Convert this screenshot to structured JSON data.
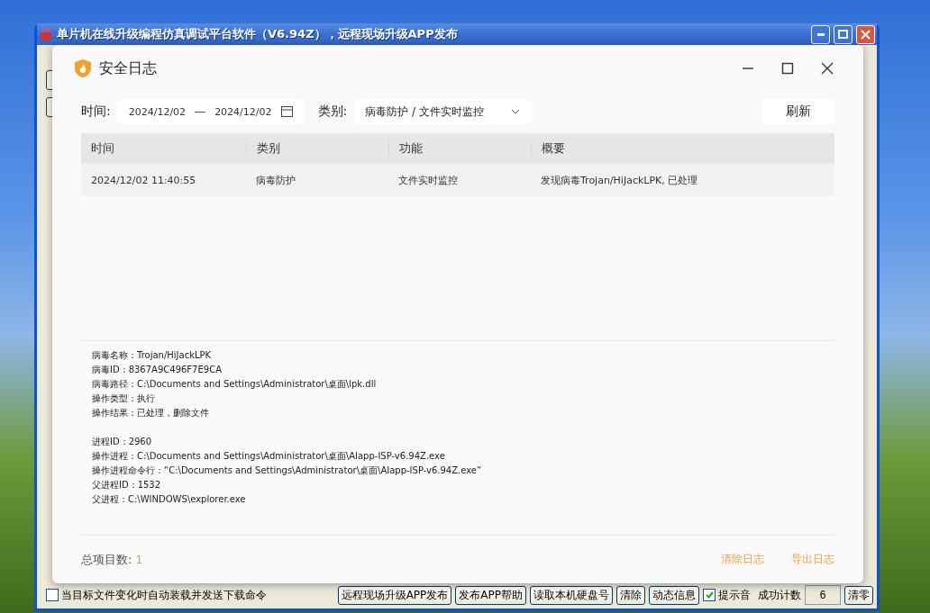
{
  "app_window": {
    "title": "单片机在线升级编程仿真调试平台软件（V6.94Z），远程现场升级APP发布",
    "bottom_bar": [
      {
        "kind": "checkbox",
        "label": "当目标文件变化时自动装载并发送下载命令",
        "checked": false
      },
      {
        "kind": "spacer"
      },
      {
        "kind": "button",
        "label": "远程现场升级APP发布"
      },
      {
        "kind": "button",
        "label": "发布APP帮助"
      },
      {
        "kind": "button",
        "label": "读取本机硬盘号"
      },
      {
        "kind": "button",
        "label": "清除"
      },
      {
        "kind": "button",
        "label": "动态信息"
      },
      {
        "kind": "checkbox",
        "label": "提示音",
        "checked": true
      },
      {
        "kind": "label",
        "label": "成功计数"
      },
      {
        "kind": "field",
        "label": "6"
      },
      {
        "kind": "button",
        "label": "清零"
      }
    ]
  },
  "dialog": {
    "title": "安全日志",
    "filters": {
      "time_label": "时间:",
      "date_from": "2024/12/02",
      "date_to": "2024/12/02",
      "category_label": "类别:",
      "category_value": "病毒防护 / 文件实时监控",
      "refresh_button": "刷新"
    },
    "table": {
      "columns": [
        "时间",
        "类别",
        "功能",
        "概要"
      ],
      "rows": [
        {
          "cells": [
            "2024/12/02 11:40:55",
            "病毒防护",
            "文件实时监控",
            "发现病毒Trojan/HiJackLPK, 已处理"
          ]
        }
      ]
    },
    "details": [
      [
        "病毒名称：Trojan/HiJackLPK",
        "病毒ID：8367A9C496F7E9CA",
        "病毒路径：C:\\Documents and Settings\\Administrator\\桌面\\lpk.dll",
        "操作类型：执行",
        "操作结果：已处理，删除文件"
      ],
      [
        "进程ID：2960",
        "操作进程：C:\\Documents and Settings\\Administrator\\桌面\\AIapp-ISP-v6.94Z.exe",
        "操作进程命令行：“C:\\Documents and Settings\\Administrator\\桌面\\AIapp-ISP-v6.94Z.exe”",
        "父进程ID：1532",
        "父进程：C:\\WINDOWS\\explorer.exe"
      ]
    ],
    "footer": {
      "total_label": "总项目数:",
      "total_value": "1",
      "actions": [
        "清除日志",
        "导出日志"
      ]
    }
  }
}
